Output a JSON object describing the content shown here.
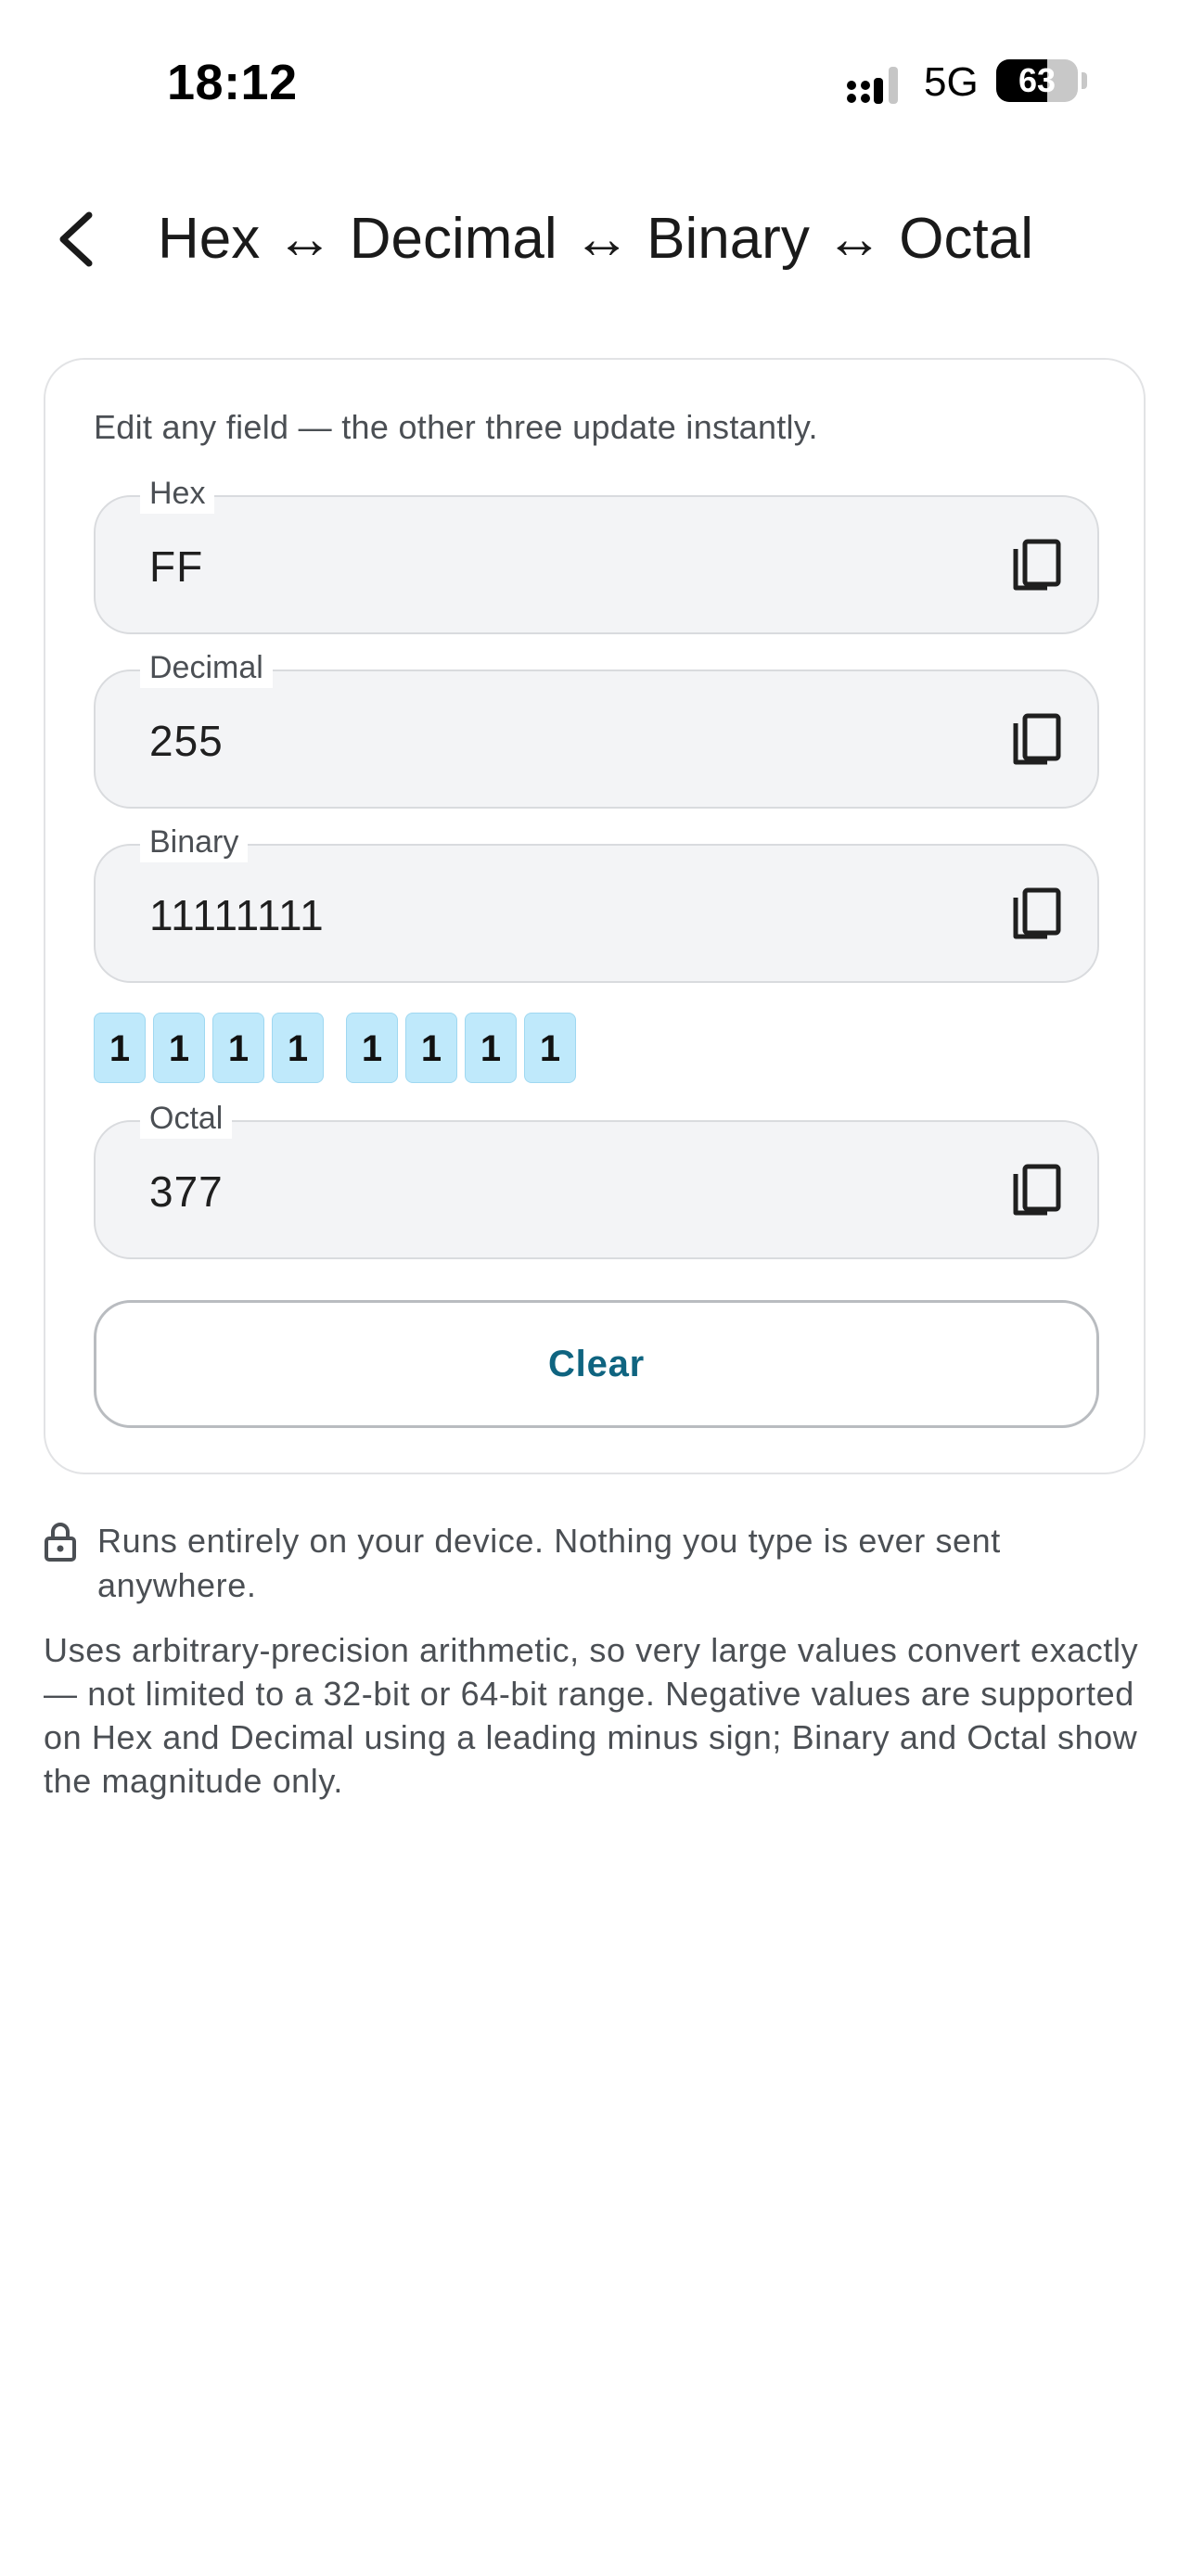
{
  "status_bar": {
    "time": "18:12",
    "network": "5G",
    "battery": "63",
    "battery_level": 0.63
  },
  "header": {
    "title": "Hex ↔ Decimal ↔ Binary ↔ Octal",
    "back_icon": "chevron-left-icon"
  },
  "card": {
    "hint": "Edit any field — the other three update instantly.",
    "fields": [
      {
        "label": "Hex",
        "value": "FF",
        "icon": "copy-icon"
      },
      {
        "label": "Decimal",
        "value": "255",
        "icon": "copy-icon"
      },
      {
        "label": "Binary",
        "value": "11111111",
        "icon": "copy-icon"
      },
      {
        "label": "Octal",
        "value": "377",
        "icon": "copy-icon"
      }
    ],
    "bits": [
      "1",
      "1",
      "1",
      "1",
      "1",
      "1",
      "1",
      "1"
    ],
    "clear_label": "Clear"
  },
  "footer": {
    "privacy": "Runs entirely on your device. Nothing you type is ever sent anywhere.",
    "privacy_icon": "lock-icon",
    "about": "Uses arbitrary-precision arithmetic, so very large values convert exactly — not limited to a 32-bit or 64-bit range. Negative values are supported on Hex and Decimal using a leading minus sign; Binary and Octal show the magnitude only."
  },
  "colors": {
    "accent": "#0f6480",
    "bit_background": "#bfe9fb",
    "field_background": "#f3f4f6"
  }
}
